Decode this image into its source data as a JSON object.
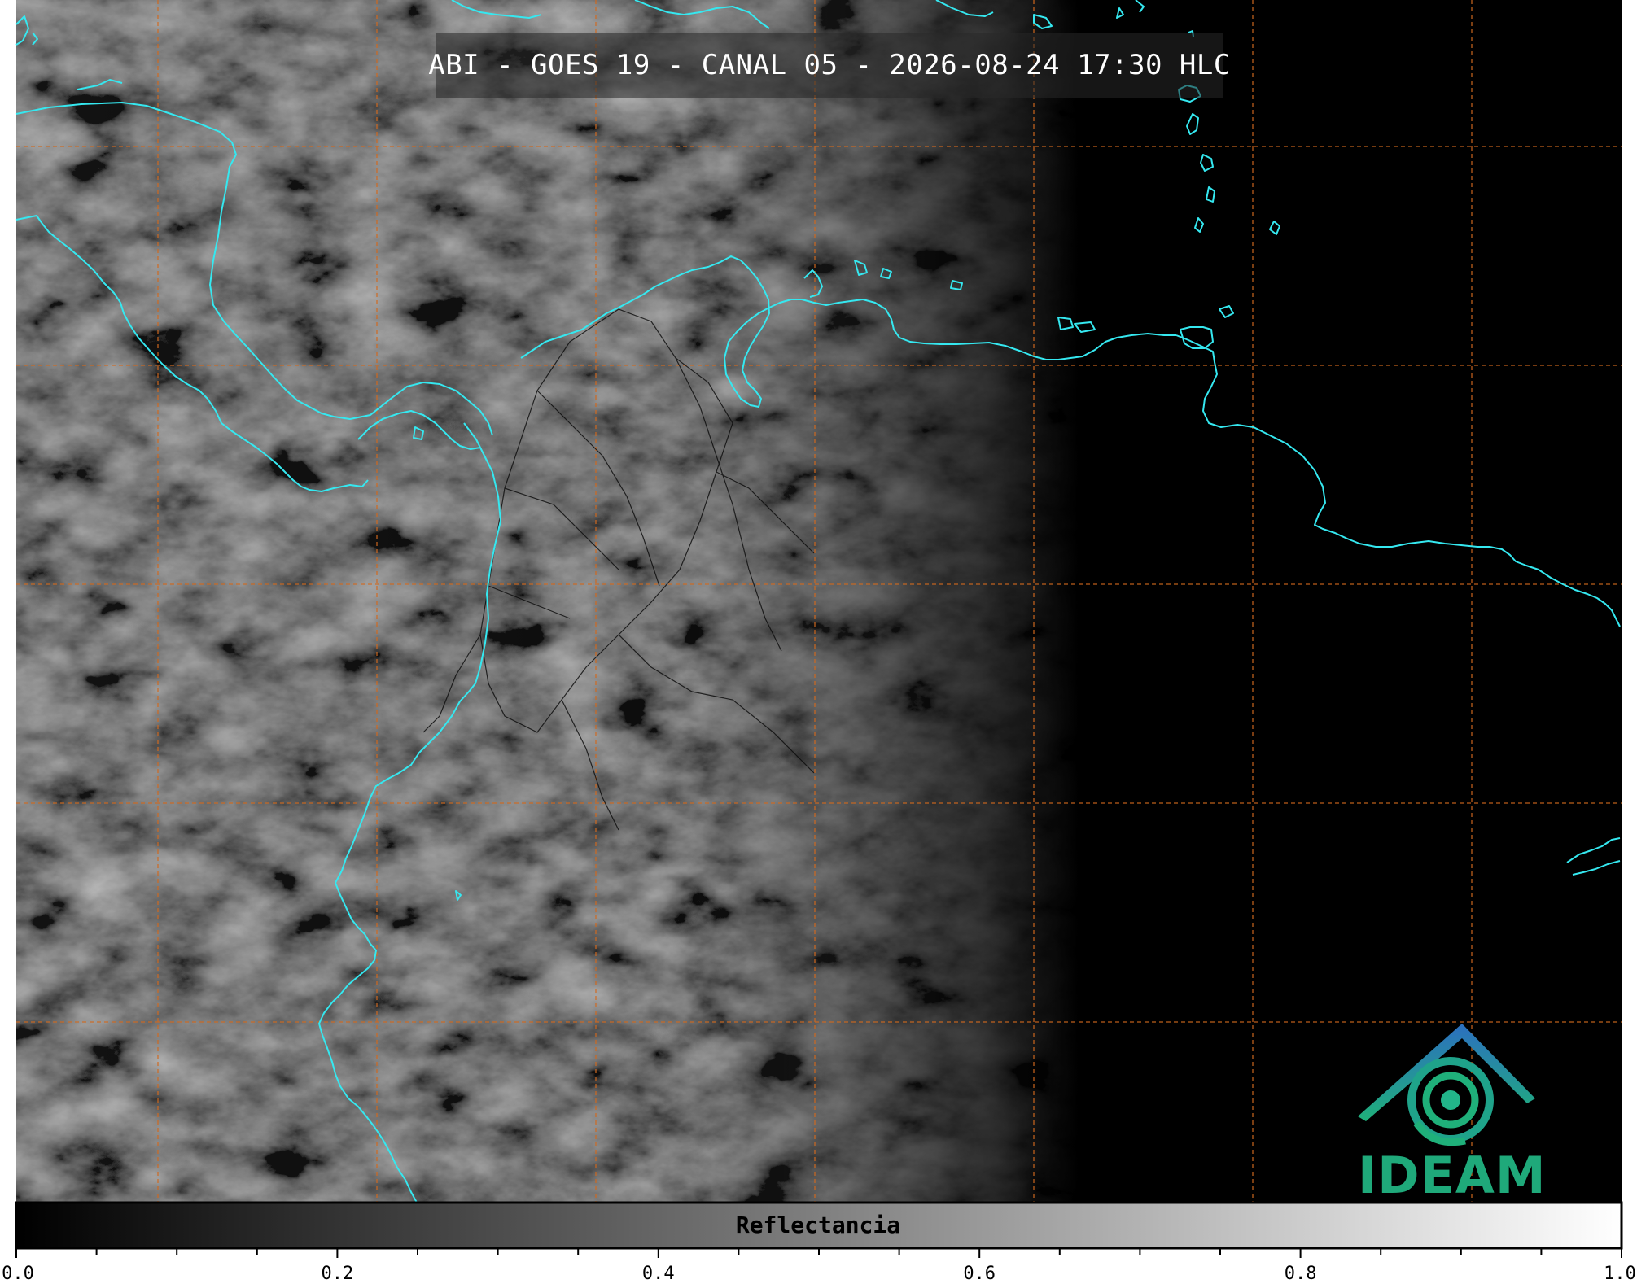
{
  "title": "ABI - GOES 19 - CANAL 05 - 2026-08-24 17:30 HLC",
  "logo": {
    "text": "IDEAM",
    "icon": "ideam-swirl-roof-icon",
    "colors": {
      "top": "#2c6fc0",
      "bottom": "#1fb07a"
    }
  },
  "colorbar": {
    "label": "Reflectancia",
    "range": [
      0.0,
      1.0
    ],
    "colormap": "greys (black to white)",
    "ticks": [
      "0.0",
      "0.2",
      "0.4",
      "0.6",
      "0.8",
      "1.0"
    ],
    "tick_values": [
      0.0,
      0.2,
      0.4,
      0.6,
      0.8,
      1.0
    ]
  },
  "map": {
    "product": "visible reflectance satellite image",
    "coastline_color": "#35e8f0",
    "gridline_color": "#d2691e",
    "gridline_style": "dashed",
    "night_side": "right"
  }
}
